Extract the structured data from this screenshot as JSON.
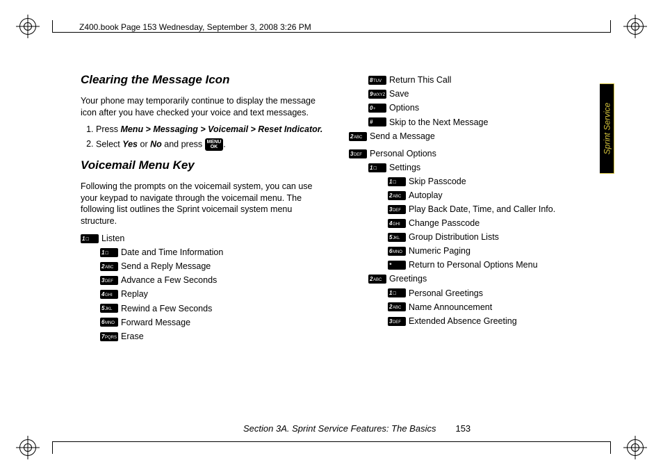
{
  "header": {
    "running": "Z400.book  Page 153  Wednesday, September 3, 2008  3:26 PM"
  },
  "sidetab": "Sprint Service",
  "left": {
    "h1": "Clearing the Message Icon",
    "p1": "Your phone may temporarily continue to display the message icon after you have checked your voice and text messages.",
    "step1a": "Press",
    "step1b": "Menu > Messaging > Voicemail > Reset Indicator.",
    "step2a": "Select",
    "step2b": "Yes",
    "step2c": "or",
    "step2d": "No",
    "step2e": "and press",
    "step2f": ".",
    "menu": "MENU",
    "ok": "OK",
    "h2": "Voicemail Menu Key",
    "p2": "Following the prompts on the voicemail system, you can use your keypad to navigate through the voicemail menu. The following list outlines the Sprint voicemail system menu structure.",
    "listen": {
      "title": "Listen",
      "i": [
        "Date and Time Information",
        "Send a Reply Message",
        "Advance a Few Seconds",
        "Replay",
        "Rewind a Few Seconds",
        "Forward Message",
        "Erase"
      ]
    }
  },
  "right": {
    "cont": [
      "Return This Call",
      "Save",
      "Options",
      "Skip to the Next Message"
    ],
    "send": "Send a Message",
    "personal": "Personal Options",
    "settings": {
      "title": "Settings",
      "i": [
        "Skip Passcode",
        "Autoplay",
        "Play Back Date, Time, and Caller Info.",
        "Change Passcode",
        "Group Distribution Lists",
        "Numeric Paging",
        "Return to Personal Options Menu"
      ]
    },
    "greet": {
      "title": "Greetings",
      "i": [
        "Personal Greetings",
        "Name Announcement",
        "Extended Absence Greeting"
      ]
    }
  },
  "footer": {
    "section": "Section 3A. Sprint Service Features: The Basics",
    "page": "153"
  }
}
